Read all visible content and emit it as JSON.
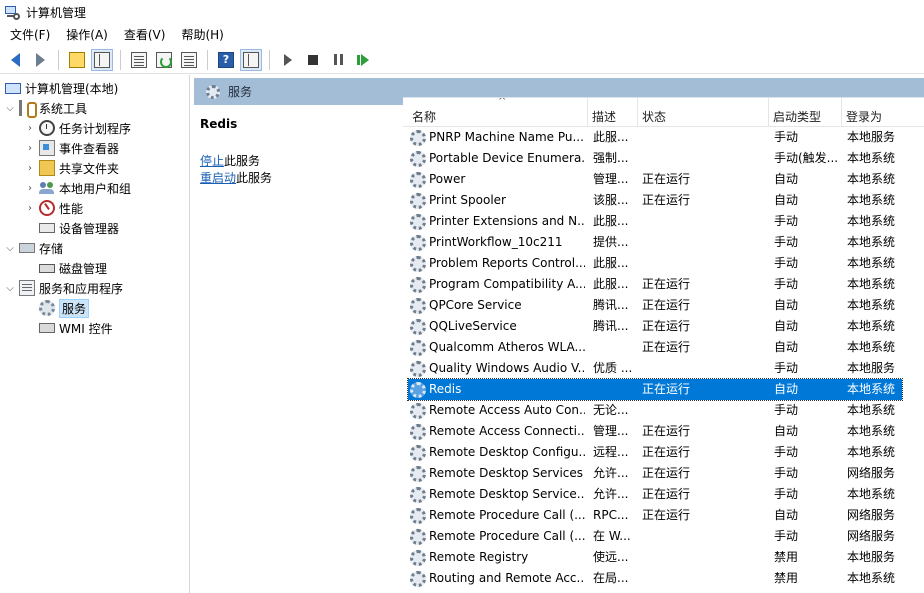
{
  "window": {
    "title": "计算机管理"
  },
  "menu": [
    "文件(F)",
    "操作(A)",
    "查看(V)",
    "帮助(H)"
  ],
  "toolbar": {
    "buttons": [
      "back-icon",
      "forward-icon",
      "up-folder-icon",
      "show-hide-tree-icon",
      "properties-icon",
      "refresh-icon",
      "export-list-icon",
      "help-icon",
      "action-pane-icon",
      "start-service-icon",
      "stop-service-icon",
      "pause-service-icon",
      "restart-service-icon"
    ]
  },
  "tree": {
    "root": "计算机管理(本地)",
    "system_tools": "系统工具",
    "task_scheduler": "任务计划程序",
    "event_viewer": "事件查看器",
    "shared_folders": "共享文件夹",
    "local_users": "本地用户和组",
    "performance": "性能",
    "device_manager": "设备管理器",
    "storage": "存储",
    "disk_management": "磁盘管理",
    "services_apps": "服务和应用程序",
    "services": "服务",
    "wmi": "WMI 控件"
  },
  "panel": {
    "header": "服务",
    "selected_service": "Redis",
    "stop_link": "停止",
    "stop_suffix": "此服务",
    "restart_link": "重启动",
    "restart_suffix": "此服务"
  },
  "columns": {
    "name": "名称",
    "desc": "描述",
    "status": "状态",
    "startup": "启动类型",
    "logon": "登录为"
  },
  "services": [
    {
      "name": "PNRP Machine Name Pu...",
      "desc": "此服...",
      "status": "",
      "startup": "手动",
      "logon": "本地服务"
    },
    {
      "name": "Portable Device Enumera...",
      "desc": "强制...",
      "status": "",
      "startup": "手动(触发...",
      "logon": "本地系统"
    },
    {
      "name": "Power",
      "desc": "管理...",
      "status": "正在运行",
      "startup": "自动",
      "logon": "本地系统"
    },
    {
      "name": "Print Spooler",
      "desc": "该服...",
      "status": "正在运行",
      "startup": "自动",
      "logon": "本地系统"
    },
    {
      "name": "Printer Extensions and N...",
      "desc": "此服...",
      "status": "",
      "startup": "手动",
      "logon": "本地系统"
    },
    {
      "name": "PrintWorkflow_10c211",
      "desc": "提供...",
      "status": "",
      "startup": "手动",
      "logon": "本地系统"
    },
    {
      "name": "Problem Reports Control...",
      "desc": "此服...",
      "status": "",
      "startup": "手动",
      "logon": "本地系统"
    },
    {
      "name": "Program Compatibility A...",
      "desc": "此服...",
      "status": "正在运行",
      "startup": "手动",
      "logon": "本地系统"
    },
    {
      "name": "QPCore Service",
      "desc": "腾讯...",
      "status": "正在运行",
      "startup": "自动",
      "logon": "本地系统"
    },
    {
      "name": "QQLiveService",
      "desc": "腾讯...",
      "status": "正在运行",
      "startup": "自动",
      "logon": "本地系统"
    },
    {
      "name": "Qualcomm Atheros WLA...",
      "desc": "",
      "status": "正在运行",
      "startup": "自动",
      "logon": "本地系统"
    },
    {
      "name": "Quality Windows Audio V...",
      "desc": "优质 ...",
      "status": "",
      "startup": "手动",
      "logon": "本地服务"
    },
    {
      "name": "Redis",
      "desc": "",
      "status": "正在运行",
      "startup": "自动",
      "logon": "本地系统"
    },
    {
      "name": "Remote Access Auto Con...",
      "desc": "无论...",
      "status": "",
      "startup": "手动",
      "logon": "本地系统"
    },
    {
      "name": "Remote Access Connecti...",
      "desc": "管理...",
      "status": "正在运行",
      "startup": "自动",
      "logon": "本地系统"
    },
    {
      "name": "Remote Desktop Configu...",
      "desc": "远程...",
      "status": "正在运行",
      "startup": "手动",
      "logon": "本地系统"
    },
    {
      "name": "Remote Desktop Services",
      "desc": "允许...",
      "status": "正在运行",
      "startup": "手动",
      "logon": "网络服务"
    },
    {
      "name": "Remote Desktop Service...",
      "desc": "允许...",
      "status": "正在运行",
      "startup": "手动",
      "logon": "本地系统"
    },
    {
      "name": "Remote Procedure Call (...",
      "desc": "RPC...",
      "status": "正在运行",
      "startup": "自动",
      "logon": "网络服务"
    },
    {
      "name": "Remote Procedure Call (...",
      "desc": "在 W...",
      "status": "",
      "startup": "手动",
      "logon": "网络服务"
    },
    {
      "name": "Remote Registry",
      "desc": "使远...",
      "status": "",
      "startup": "禁用",
      "logon": "本地服务"
    },
    {
      "name": "Routing and Remote Acc...",
      "desc": "在局...",
      "status": "",
      "startup": "禁用",
      "logon": "本地系统"
    }
  ],
  "selected_index": 12,
  "colors": {
    "selection": "#0078d7",
    "header_band": "#a4bdd6",
    "link": "#1a5fb4"
  }
}
